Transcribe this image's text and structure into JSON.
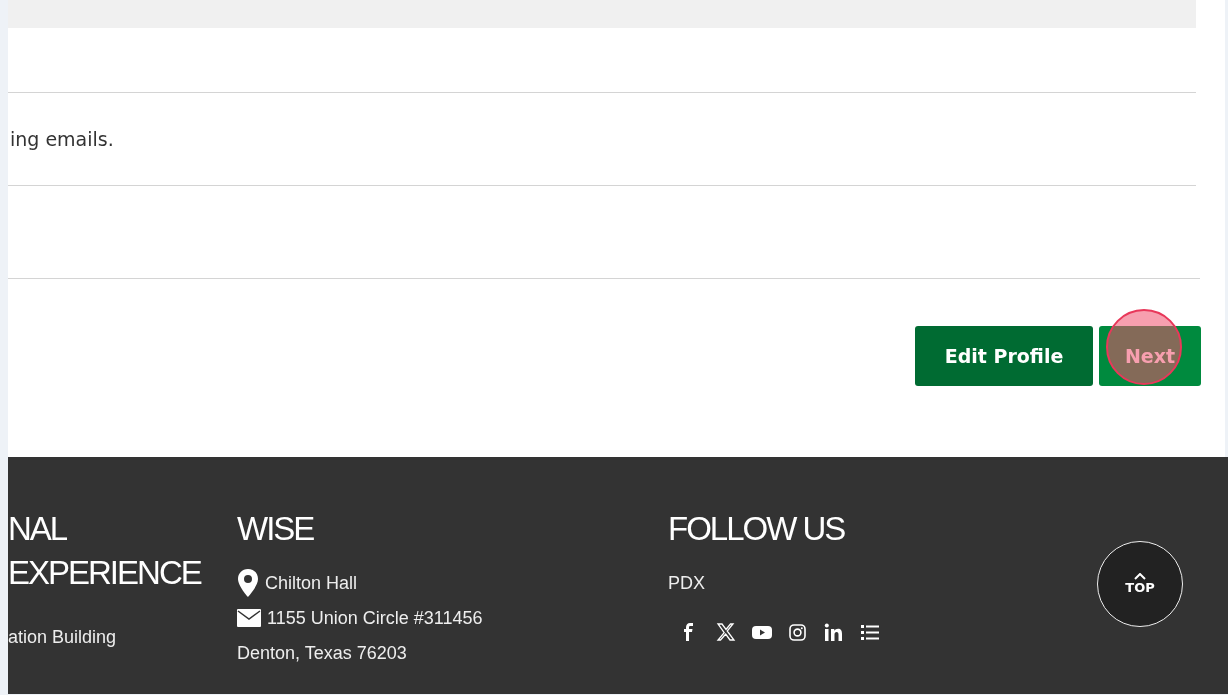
{
  "notice_text": "ing emails.",
  "buttons": [
    {
      "label": "Edit Profile",
      "kind": "secondary"
    },
    {
      "label": "Next",
      "kind": "primary"
    }
  ],
  "footer": {
    "columns": [
      {
        "heading_lines": [
          "NAL",
          "EXPERIENCE"
        ],
        "lines": [
          {
            "kind": "plain",
            "text": "ation Building"
          }
        ]
      },
      {
        "heading_lines": [
          "WISE"
        ],
        "lines": [
          {
            "kind": "location",
            "text": "Chilton Hall"
          },
          {
            "kind": "mail",
            "text": "1155 Union Circle #311456"
          },
          {
            "kind": "plain",
            "text": "Denton, Texas 76203"
          }
        ]
      },
      {
        "heading_lines": [
          "FOLLOW US"
        ],
        "lines": [
          {
            "kind": "plain",
            "text": "PDX"
          }
        ],
        "kind": "social"
      }
    ],
    "top_button": {
      "label": "TOP"
    }
  }
}
